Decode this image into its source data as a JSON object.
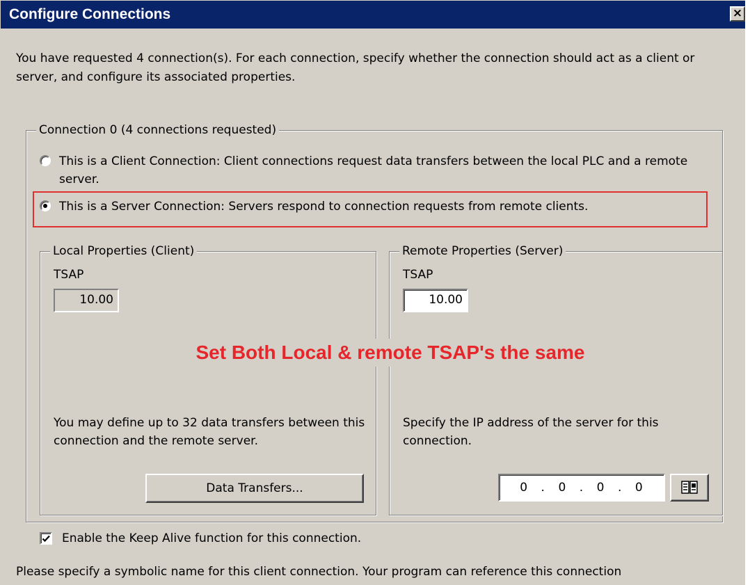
{
  "window": {
    "title": "Configure Connections",
    "close_glyph": "×"
  },
  "intro": "You have requested 4 connection(s).  For each connection, specify whether the connection should act as a client or server, and configure its associated properties.",
  "connection_group": {
    "legend": "Connection 0 (4 connections requested)",
    "client_option": {
      "label": "This is a Client Connection: Client connections request data transfers between the local PLC and a remote server.",
      "checked": false
    },
    "server_option": {
      "label": "This is a Server Connection: Servers respond to connection requests from remote clients.",
      "checked": true
    }
  },
  "local_properties": {
    "legend": "Local Properties (Client)",
    "tsap_label": "TSAP",
    "tsap_value": "10.00",
    "description": "You may define up to 32 data transfers between this connection and the remote server.",
    "data_transfers_button": "Data Transfers..."
  },
  "remote_properties": {
    "legend": "Remote Properties (Server)",
    "tsap_label": "TSAP",
    "tsap_value": "10.00",
    "description": "Specify the IP address of the server for this connection.",
    "ip_octets": [
      "0",
      "0",
      "0",
      "0"
    ],
    "ip_separator": ".",
    "browse_icon": "address-book-icon"
  },
  "annotation": "Set Both Local & remote TSAP's the same",
  "keep_alive": {
    "label": "Enable the Keep Alive function for this connection.",
    "checked": true
  },
  "symbolic_name_text": "Please specify a symbolic name for this client connection.  Your program can reference this connection",
  "colors": {
    "title_bar": "#0a246a",
    "dialog_face": "#d4d0c8",
    "annotation_red": "#e6262a",
    "highlight_border": "#e03030"
  }
}
